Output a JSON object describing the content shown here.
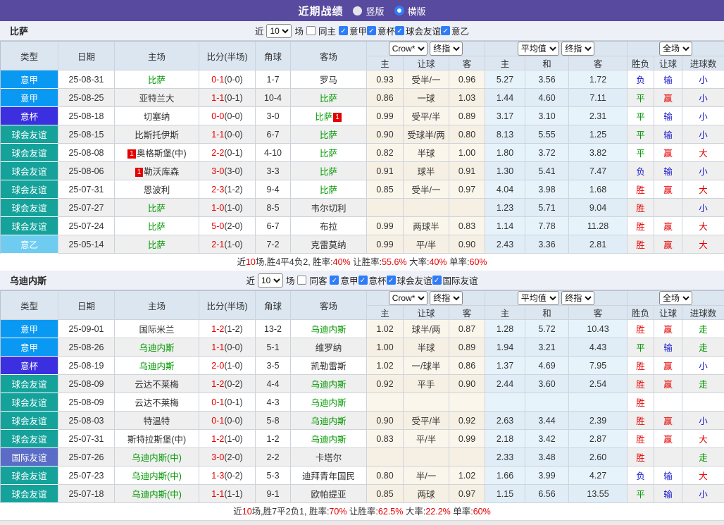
{
  "topbar": {
    "title": "近期战绩",
    "options": [
      {
        "label": "竖版",
        "selected": false
      },
      {
        "label": "横版",
        "selected": true
      }
    ]
  },
  "columns": {
    "left": [
      "类型",
      "日期",
      "主场",
      "比分(半场)",
      "角球",
      "客场"
    ],
    "dd_company": "Crow*",
    "dd_final": "终指",
    "dd_avg": "平均值",
    "dd_final2": "终指",
    "dd_scope": "全场",
    "sub": [
      "主",
      "让球",
      "客",
      "主",
      "和",
      "客",
      "胜负",
      "让球",
      "进球数"
    ]
  },
  "league_colors": {
    "意甲": "#0a99f2",
    "意杯": "#3c2fe0",
    "球会友谊": "#14a29b",
    "意乙": "#6fccf1",
    "国际友谊": "#5a6cc5"
  },
  "colors": {
    "topbar": "#584a9e",
    "team_green": "#009900",
    "score_red": "#e60000",
    "win_red": "#e60000",
    "lose_blue": "#1717cc",
    "draw_green": "#009900"
  },
  "tables": [
    {
      "team": "比萨",
      "filter": {
        "near": "近",
        "count": "10",
        "games": "场",
        "same": "同主",
        "leagues": [
          "意甲",
          "意杯",
          "球会友谊",
          "意乙"
        ]
      },
      "rows": [
        {
          "league": "意甲",
          "date": "25-08-31",
          "home": {
            "t": "比萨",
            "green": true
          },
          "score": "0-1",
          "half": "(0-0)",
          "corner": "1-7",
          "away": {
            "t": "罗马",
            "green": false
          },
          "odds": [
            "0.93",
            "受半/一",
            "0.96"
          ],
          "avg": [
            "5.27",
            "3.56",
            "1.72"
          ],
          "res": [
            [
              "负",
              "b"
            ],
            [
              "输",
              "b"
            ],
            [
              "小",
              "b"
            ]
          ]
        },
        {
          "league": "意甲",
          "date": "25-08-25",
          "home": {
            "t": "亚特兰大",
            "green": false
          },
          "score": "1-1",
          "half": "(0-1)",
          "corner": "10-4",
          "away": {
            "t": "比萨",
            "green": true
          },
          "odds": [
            "0.86",
            "一球",
            "1.03"
          ],
          "avg": [
            "1.44",
            "4.60",
            "7.11"
          ],
          "res": [
            [
              "平",
              "g"
            ],
            [
              "赢",
              "r"
            ],
            [
              "小",
              "b"
            ]
          ]
        },
        {
          "league": "意杯",
          "date": "25-08-18",
          "home": {
            "t": "切塞纳",
            "green": false
          },
          "score": "0-0",
          "half": "(0-0)",
          "corner": "3-0",
          "away": {
            "t": "比萨",
            "green": true,
            "post": "1"
          },
          "odds": [
            "0.99",
            "受平/半",
            "0.89"
          ],
          "avg": [
            "3.17",
            "3.10",
            "2.31"
          ],
          "res": [
            [
              "平",
              "g"
            ],
            [
              "输",
              "b"
            ],
            [
              "小",
              "b"
            ]
          ]
        },
        {
          "league": "球会友谊",
          "date": "25-08-15",
          "home": {
            "t": "比斯托伊斯",
            "green": false
          },
          "score": "1-1",
          "half": "(0-0)",
          "corner": "6-7",
          "away": {
            "t": "比萨",
            "green": true
          },
          "odds": [
            "0.90",
            "受球半/两",
            "0.80"
          ],
          "avg": [
            "8.13",
            "5.55",
            "1.25"
          ],
          "res": [
            [
              "平",
              "g"
            ],
            [
              "输",
              "b"
            ],
            [
              "小",
              "b"
            ]
          ]
        },
        {
          "league": "球会友谊",
          "date": "25-08-08",
          "home": {
            "t": "奥格斯堡(中)",
            "green": false,
            "pre": "1"
          },
          "score": "2-2",
          "half": "(0-1)",
          "corner": "4-10",
          "away": {
            "t": "比萨",
            "green": true
          },
          "odds": [
            "0.82",
            "半球",
            "1.00"
          ],
          "avg": [
            "1.80",
            "3.72",
            "3.82"
          ],
          "res": [
            [
              "平",
              "g"
            ],
            [
              "赢",
              "r"
            ],
            [
              "大",
              "r"
            ]
          ]
        },
        {
          "league": "球会友谊",
          "date": "25-08-06",
          "home": {
            "t": "勒沃库森",
            "green": false,
            "pre": "1"
          },
          "score": "3-0",
          "half": "(3-0)",
          "corner": "3-3",
          "away": {
            "t": "比萨",
            "green": true
          },
          "odds": [
            "0.91",
            "球半",
            "0.91"
          ],
          "avg": [
            "1.30",
            "5.41",
            "7.47"
          ],
          "res": [
            [
              "负",
              "b"
            ],
            [
              "输",
              "b"
            ],
            [
              "小",
              "b"
            ]
          ]
        },
        {
          "league": "球会友谊",
          "date": "25-07-31",
          "home": {
            "t": "恩波利",
            "green": false
          },
          "score": "2-3",
          "half": "(1-2)",
          "corner": "9-4",
          "away": {
            "t": "比萨",
            "green": true
          },
          "odds": [
            "0.85",
            "受半/一",
            "0.97"
          ],
          "avg": [
            "4.04",
            "3.98",
            "1.68"
          ],
          "res": [
            [
              "胜",
              "r"
            ],
            [
              "赢",
              "r"
            ],
            [
              "大",
              "r"
            ]
          ]
        },
        {
          "league": "球会友谊",
          "date": "25-07-27",
          "home": {
            "t": "比萨",
            "green": true
          },
          "score": "1-0",
          "half": "(1-0)",
          "corner": "8-5",
          "away": {
            "t": "韦尔切利",
            "green": false
          },
          "odds": [
            "",
            "",
            ""
          ],
          "avg": [
            "1.23",
            "5.71",
            "9.04"
          ],
          "res": [
            [
              "胜",
              "r"
            ],
            [
              "",
              ""
            ],
            [
              "小",
              "b"
            ]
          ]
        },
        {
          "league": "球会友谊",
          "date": "25-07-24",
          "home": {
            "t": "比萨",
            "green": true
          },
          "score": "5-0",
          "half": "(2-0)",
          "corner": "6-7",
          "away": {
            "t": "布拉",
            "green": false
          },
          "odds": [
            "0.99",
            "两球半",
            "0.83"
          ],
          "avg": [
            "1.14",
            "7.78",
            "11.28"
          ],
          "res": [
            [
              "胜",
              "r"
            ],
            [
              "赢",
              "r"
            ],
            [
              "大",
              "r"
            ]
          ]
        },
        {
          "league": "意乙",
          "date": "25-05-14",
          "home": {
            "t": "比萨",
            "green": true
          },
          "score": "2-1",
          "half": "(1-0)",
          "corner": "7-2",
          "away": {
            "t": "克雷莫纳",
            "green": false
          },
          "odds": [
            "0.99",
            "平/半",
            "0.90"
          ],
          "avg": [
            "2.43",
            "3.36",
            "2.81"
          ],
          "res": [
            [
              "胜",
              "r"
            ],
            [
              "赢",
              "r"
            ],
            [
              "大",
              "r"
            ]
          ]
        }
      ],
      "summary": [
        [
          "近",
          false
        ],
        [
          "10",
          true
        ],
        [
          "场,胜4平4负2, 胜率:",
          false
        ],
        [
          "40%",
          true
        ],
        [
          " 让胜率:",
          false
        ],
        [
          "55.6%",
          true
        ],
        [
          " 大率:",
          false
        ],
        [
          "40%",
          true
        ],
        [
          " 单率:",
          false
        ],
        [
          "60%",
          true
        ]
      ]
    },
    {
      "team": "乌迪内斯",
      "filter": {
        "near": "近",
        "count": "10",
        "games": "场",
        "same": "同客",
        "leagues": [
          "意甲",
          "意杯",
          "球会友谊",
          "国际友谊"
        ]
      },
      "rows": [
        {
          "league": "意甲",
          "date": "25-09-01",
          "home": {
            "t": "国际米兰",
            "green": false
          },
          "score": "1-2",
          "half": "(1-2)",
          "corner": "13-2",
          "away": {
            "t": "乌迪内斯",
            "green": true
          },
          "odds": [
            "1.02",
            "球半/两",
            "0.87"
          ],
          "avg": [
            "1.28",
            "5.72",
            "10.43"
          ],
          "res": [
            [
              "胜",
              "r"
            ],
            [
              "赢",
              "r"
            ],
            [
              "走",
              "g"
            ]
          ]
        },
        {
          "league": "意甲",
          "date": "25-08-26",
          "home": {
            "t": "乌迪内斯",
            "green": true
          },
          "score": "1-1",
          "half": "(0-0)",
          "corner": "5-1",
          "away": {
            "t": "维罗纳",
            "green": false
          },
          "odds": [
            "1.00",
            "半球",
            "0.89"
          ],
          "avg": [
            "1.94",
            "3.21",
            "4.43"
          ],
          "res": [
            [
              "平",
              "g"
            ],
            [
              "输",
              "b"
            ],
            [
              "走",
              "g"
            ]
          ]
        },
        {
          "league": "意杯",
          "date": "25-08-19",
          "home": {
            "t": "乌迪内斯",
            "green": true
          },
          "score": "2-0",
          "half": "(1-0)",
          "corner": "3-5",
          "away": {
            "t": "凯勒雷斯",
            "green": false
          },
          "odds": [
            "1.02",
            "一/球半",
            "0.86"
          ],
          "avg": [
            "1.37",
            "4.69",
            "7.95"
          ],
          "res": [
            [
              "胜",
              "r"
            ],
            [
              "赢",
              "r"
            ],
            [
              "小",
              "b"
            ]
          ]
        },
        {
          "league": "球会友谊",
          "date": "25-08-09",
          "home": {
            "t": "云达不莱梅",
            "green": false
          },
          "score": "1-2",
          "half": "(0-2)",
          "corner": "4-4",
          "away": {
            "t": "乌迪内斯",
            "green": true
          },
          "odds": [
            "0.92",
            "平手",
            "0.90"
          ],
          "avg": [
            "2.44",
            "3.60",
            "2.54"
          ],
          "res": [
            [
              "胜",
              "r"
            ],
            [
              "赢",
              "r"
            ],
            [
              "走",
              "g"
            ]
          ]
        },
        {
          "league": "球会友谊",
          "date": "25-08-09",
          "home": {
            "t": "云达不莱梅",
            "green": false
          },
          "score": "0-1",
          "half": "(0-1)",
          "corner": "4-3",
          "away": {
            "t": "乌迪内斯",
            "green": true
          },
          "odds": [
            "",
            "",
            ""
          ],
          "avg": [
            "",
            "",
            ""
          ],
          "res": [
            [
              "胜",
              "r"
            ],
            [
              "",
              ""
            ],
            [
              "",
              ""
            ]
          ]
        },
        {
          "league": "球会友谊",
          "date": "25-08-03",
          "home": {
            "t": "特温特",
            "green": false
          },
          "score": "0-1",
          "half": "(0-0)",
          "corner": "5-8",
          "away": {
            "t": "乌迪内斯",
            "green": true
          },
          "odds": [
            "0.90",
            "受平/半",
            "0.92"
          ],
          "avg": [
            "2.63",
            "3.44",
            "2.39"
          ],
          "res": [
            [
              "胜",
              "r"
            ],
            [
              "赢",
              "r"
            ],
            [
              "小",
              "b"
            ]
          ]
        },
        {
          "league": "球会友谊",
          "date": "25-07-31",
          "home": {
            "t": "斯特拉斯堡(中)",
            "green": false
          },
          "score": "1-2",
          "half": "(1-0)",
          "corner": "1-2",
          "away": {
            "t": "乌迪内斯",
            "green": true
          },
          "odds": [
            "0.83",
            "平/半",
            "0.99"
          ],
          "avg": [
            "2.18",
            "3.42",
            "2.87"
          ],
          "res": [
            [
              "胜",
              "r"
            ],
            [
              "赢",
              "r"
            ],
            [
              "大",
              "r"
            ]
          ]
        },
        {
          "league": "国际友谊",
          "date": "25-07-26",
          "home": {
            "t": "乌迪内斯(中)",
            "green": true
          },
          "score": "3-0",
          "half": "(2-0)",
          "corner": "2-2",
          "away": {
            "t": "卡塔尔",
            "green": false
          },
          "odds": [
            "",
            "",
            ""
          ],
          "avg": [
            "2.33",
            "3.48",
            "2.60"
          ],
          "res": [
            [
              "胜",
              "r"
            ],
            [
              "",
              ""
            ],
            [
              "走",
              "g"
            ]
          ]
        },
        {
          "league": "球会友谊",
          "date": "25-07-23",
          "home": {
            "t": "乌迪内斯(中)",
            "green": true
          },
          "score": "1-3",
          "half": "(0-2)",
          "corner": "5-3",
          "away": {
            "t": "迪拜青年国民",
            "green": false
          },
          "odds": [
            "0.80",
            "半/一",
            "1.02"
          ],
          "avg": [
            "1.66",
            "3.99",
            "4.27"
          ],
          "res": [
            [
              "负",
              "b"
            ],
            [
              "输",
              "b"
            ],
            [
              "大",
              "r"
            ]
          ]
        },
        {
          "league": "球会友谊",
          "date": "25-07-18",
          "home": {
            "t": "乌迪内斯(中)",
            "green": true
          },
          "score": "1-1",
          "half": "(1-1)",
          "corner": "9-1",
          "away": {
            "t": "欧帕提亚",
            "green": false
          },
          "odds": [
            "0.85",
            "两球",
            "0.97"
          ],
          "avg": [
            "1.15",
            "6.56",
            "13.55"
          ],
          "res": [
            [
              "平",
              "g"
            ],
            [
              "输",
              "b"
            ],
            [
              "小",
              "b"
            ]
          ]
        }
      ],
      "summary": [
        [
          "近",
          false
        ],
        [
          "10",
          true
        ],
        [
          "场,胜7平2负1, 胜率:",
          false
        ],
        [
          "70%",
          true
        ],
        [
          " 让胜率:",
          false
        ],
        [
          "62.5%",
          true
        ],
        [
          " 大率:",
          false
        ],
        [
          "22.2%",
          true
        ],
        [
          " 单率:",
          false
        ],
        [
          "60%",
          true
        ]
      ]
    }
  ]
}
